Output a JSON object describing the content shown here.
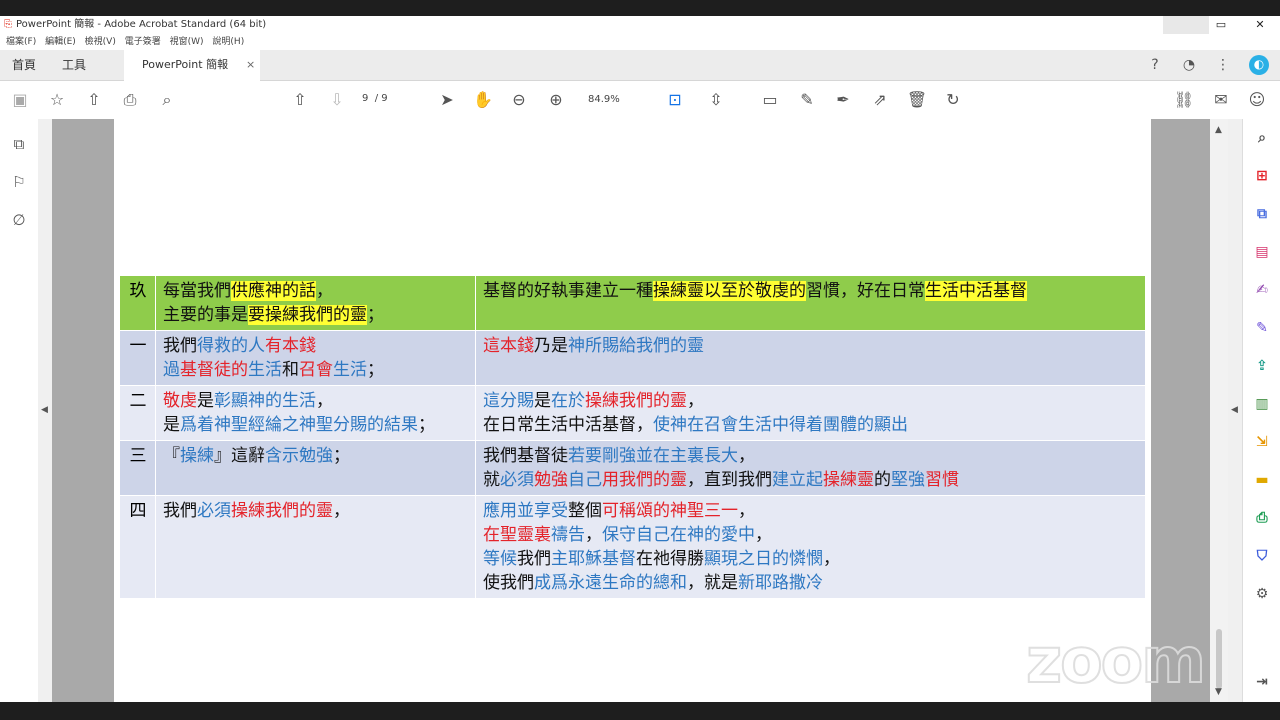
{
  "window": {
    "title": "PowerPoint 簡報 - Adobe Acrobat Standard (64 bit)",
    "app_icon": "pdf-icon",
    "restore_symbol": "▭",
    "close_symbol": "✕"
  },
  "menu": [
    "檔案(F)",
    "編輯(E)",
    "檢視(V)",
    "電子簽署",
    "視窗(W)",
    "說明(H)"
  ],
  "tabs": {
    "home": "首頁",
    "tools": "工具",
    "doc": "PowerPoint 簡報",
    "close": "×"
  },
  "toolbar": {
    "page_current": "9",
    "page_sep": "/",
    "page_total": "9",
    "zoom": "84.9%"
  },
  "table": {
    "header": {
      "num": "玖",
      "left": [
        [
          [
            "每當我們",
            "k"
          ],
          [
            "供應神的話",
            "ky"
          ],
          [
            "，",
            "k"
          ]
        ],
        [
          [
            "主要的事是",
            "k"
          ],
          [
            "要操練我們的靈",
            "ky"
          ],
          [
            "；",
            "k"
          ]
        ]
      ],
      "right": [
        [
          [
            "基督的好執事建立一種",
            "k"
          ],
          [
            "操練靈以至於敬虔的",
            "ky"
          ],
          [
            "習慣，好在日常",
            "k"
          ],
          [
            "生活中活基督",
            "ky"
          ]
        ]
      ]
    },
    "rows": [
      {
        "num": "一",
        "left": [
          [
            [
              "我們",
              "k"
            ],
            [
              "得救的人",
              "b"
            ],
            [
              "有本錢",
              "r"
            ]
          ],
          [
            [
              "過",
              "b"
            ],
            [
              "基督徒的",
              "r"
            ],
            [
              "生活",
              "b"
            ],
            [
              "和",
              "k"
            ],
            [
              "召會",
              "r"
            ],
            [
              "生活",
              "b"
            ],
            [
              "；",
              "k"
            ]
          ]
        ],
        "right": [
          [
            [
              "這本錢",
              "r"
            ],
            [
              "乃是",
              "k"
            ],
            [
              "神所賜給我們的靈",
              "b"
            ]
          ]
        ]
      },
      {
        "num": "二",
        "left": [
          [
            [
              "敬虔",
              "r"
            ],
            [
              "是",
              "k"
            ],
            [
              "彰顯神的生活",
              "b"
            ],
            [
              "，",
              "k"
            ]
          ],
          [
            [
              "是",
              "k"
            ],
            [
              "爲着神聖經綸之神聖分賜的結果",
              "b"
            ],
            [
              "；",
              "k"
            ]
          ]
        ],
        "right": [
          [
            [
              "這分賜",
              "b"
            ],
            [
              "是",
              "k"
            ],
            [
              "在於",
              "b"
            ],
            [
              "操練我們的靈",
              "r"
            ],
            [
              "，",
              "k"
            ]
          ],
          [
            [
              "在日常生活中活基督，",
              "k"
            ],
            [
              "使神在召會生活中得着團體的顯出",
              "b"
            ]
          ]
        ]
      },
      {
        "num": "三",
        "left": [
          [
            [
              "『",
              "k"
            ],
            [
              "操練",
              "b"
            ],
            [
              "』這辭",
              "k"
            ],
            [
              "含示勉強",
              "b"
            ],
            [
              "；",
              "k"
            ]
          ]
        ],
        "right": [
          [
            [
              "我們基督徒",
              "k"
            ],
            [
              "若要剛強並在主裏長大",
              "b"
            ],
            [
              "，",
              "k"
            ]
          ],
          [
            [
              "就",
              "k"
            ],
            [
              "必須",
              "b"
            ],
            [
              "勉強",
              "r"
            ],
            [
              "自己",
              "b"
            ],
            [
              "用我們的靈",
              "r"
            ],
            [
              "，直到我們",
              "k"
            ],
            [
              "建立起",
              "b"
            ],
            [
              "操練靈",
              "r"
            ],
            [
              "的",
              "k"
            ],
            [
              "堅強",
              "b"
            ],
            [
              "習慣",
              "r"
            ]
          ]
        ]
      },
      {
        "num": "四",
        "left": [
          [
            [
              "我們",
              "k"
            ],
            [
              "必須",
              "b"
            ],
            [
              "操練我們的靈",
              "r"
            ],
            [
              "，",
              "k"
            ]
          ]
        ],
        "right": [
          [
            [
              "應用並享受",
              "b"
            ],
            [
              "整個",
              "k"
            ],
            [
              "可稱頌的神聖三一",
              "r"
            ],
            [
              "，",
              "k"
            ]
          ],
          [
            [
              "在聖靈裏",
              "r"
            ],
            [
              "禱告",
              "b"
            ],
            [
              "，",
              "k"
            ],
            [
              "保守自己在神的愛中",
              "b"
            ],
            [
              "，",
              "k"
            ]
          ],
          [
            [
              "等候",
              "b"
            ],
            [
              "我們",
              "k"
            ],
            [
              "主耶穌基督",
              "b"
            ],
            [
              "在祂得勝",
              "k"
            ],
            [
              "顯現之日的憐憫",
              "b"
            ],
            [
              "，",
              "k"
            ]
          ],
          [
            [
              "使我們",
              "k"
            ],
            [
              "成爲永遠生命的總和",
              "b"
            ],
            [
              "，就是",
              "k"
            ],
            [
              "新耶路撒冷",
              "b"
            ]
          ]
        ]
      }
    ]
  },
  "watermark": "zoom",
  "colors": {
    "header_bg": "#8fcc4b",
    "row_dark": "#cdd4e8",
    "row_light": "#e6e9f4",
    "blue": "#2e78c2",
    "red": "#e4232a",
    "highlight": "#ffff33"
  }
}
